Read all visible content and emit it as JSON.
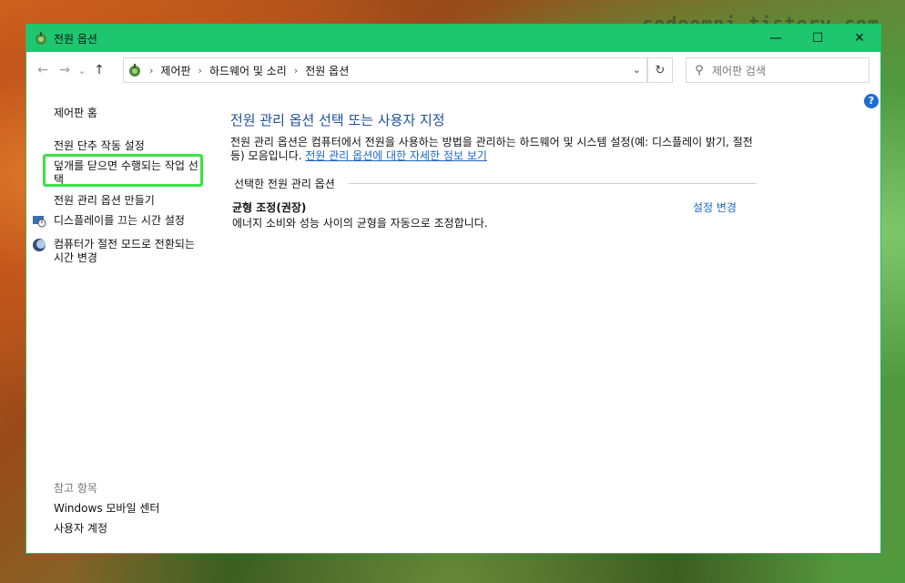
{
  "watermark": "codeomni.tistory.com",
  "window": {
    "title": "전원 옵션",
    "controls": {
      "minimize": "—",
      "maximize": "☐",
      "close": "✕"
    }
  },
  "address": {
    "back": "←",
    "forward": "→",
    "recent": "⌄",
    "up": "↑",
    "breadcrumbs": [
      "제어판",
      "하드웨어 및 소리",
      "전원 옵션"
    ],
    "dropdown": "⌄",
    "refresh": "↻",
    "search_placeholder": "제어판 검색"
  },
  "help": "?",
  "leftnav": {
    "home": "제어판 홈",
    "items": [
      "전원 단추 작동 설정",
      "덮개를 닫으면 수행되는 작업 선택",
      "전원 관리 옵션 만들기",
      "디스플레이를 끄는 시간 설정",
      "컴퓨터가 절전 모드로 전환되는 시간 변경"
    ],
    "see_also_label": "참고 항목",
    "see_also": [
      "Windows 모바일 센터",
      "사용자 계정"
    ]
  },
  "main": {
    "heading": "전원 관리 옵션 선택 또는 사용자 지정",
    "description": "전원 관리 옵션은 컴퓨터에서 전원을 사용하는 방법을 관리하는 하드웨어 및 시스템 설정(예: 디스플레이 밝기, 절전 등) 모음입니다. ",
    "more_info_link": "전원 관리 옵션에 대한 자세한 정보 보기",
    "section_title": "선택한 전원 관리 옵션",
    "plan": {
      "name": "균형 조정(권장)",
      "description": "에너지 소비와 성능 사이의 균형을 자동으로 조정합니다.",
      "change_link": "설정 변경"
    }
  },
  "colors": {
    "titlebar": "#1ec66f",
    "link": "#1e66c9",
    "heading": "#1e4f9a",
    "highlight": "#3ee04a"
  }
}
